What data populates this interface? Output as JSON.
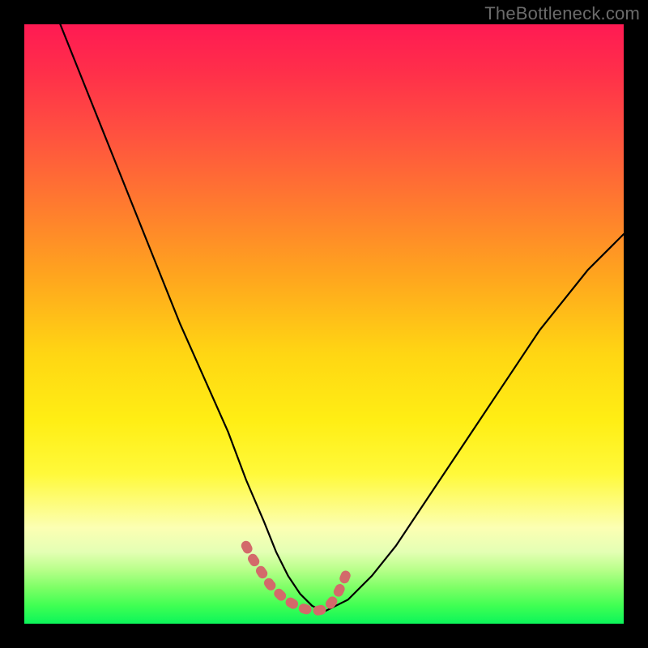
{
  "watermark": {
    "text": "TheBottleneck.com"
  },
  "chart_data": {
    "type": "line",
    "title": "",
    "xlabel": "",
    "ylabel": "",
    "xlim": [
      0,
      100
    ],
    "ylim": [
      0,
      100
    ],
    "grid": false,
    "legend": false,
    "background_gradient": {
      "direction": "vertical",
      "stops": [
        {
          "pos": 0,
          "color": "#ff1a53"
        },
        {
          "pos": 18,
          "color": "#ff5040"
        },
        {
          "pos": 42,
          "color": "#ffa51e"
        },
        {
          "pos": 66,
          "color": "#ffee14"
        },
        {
          "pos": 84,
          "color": "#fcffb3"
        },
        {
          "pos": 94,
          "color": "#7dff66"
        },
        {
          "pos": 100,
          "color": "#0cf55a"
        }
      ]
    },
    "series": [
      {
        "name": "bottleneck-curve",
        "color": "#000000",
        "x": [
          6,
          10,
          14,
          18,
          22,
          26,
          30,
          34,
          37,
          40,
          42,
          44,
          46,
          48,
          50,
          54,
          58,
          62,
          66,
          70,
          74,
          78,
          82,
          86,
          90,
          94,
          98,
          100
        ],
        "values": [
          100,
          90,
          80,
          70,
          60,
          50,
          41,
          32,
          24,
          17,
          12,
          8,
          5,
          3,
          2,
          4,
          8,
          13,
          19,
          25,
          31,
          37,
          43,
          49,
          54,
          59,
          63,
          65
        ]
      },
      {
        "name": "optimal-range-marker",
        "color": "#d36a6a",
        "x": [
          37,
          38,
          39,
          40,
          41,
          42,
          43,
          44,
          45,
          46,
          47,
          48,
          49,
          50,
          51,
          52,
          53,
          54
        ],
        "values": [
          13,
          11,
          9.5,
          8,
          6.5,
          5.5,
          4.5,
          3.8,
          3.2,
          2.7,
          2.4,
          2.2,
          2.2,
          2.4,
          3.2,
          4.5,
          6.5,
          9
        ]
      }
    ]
  }
}
